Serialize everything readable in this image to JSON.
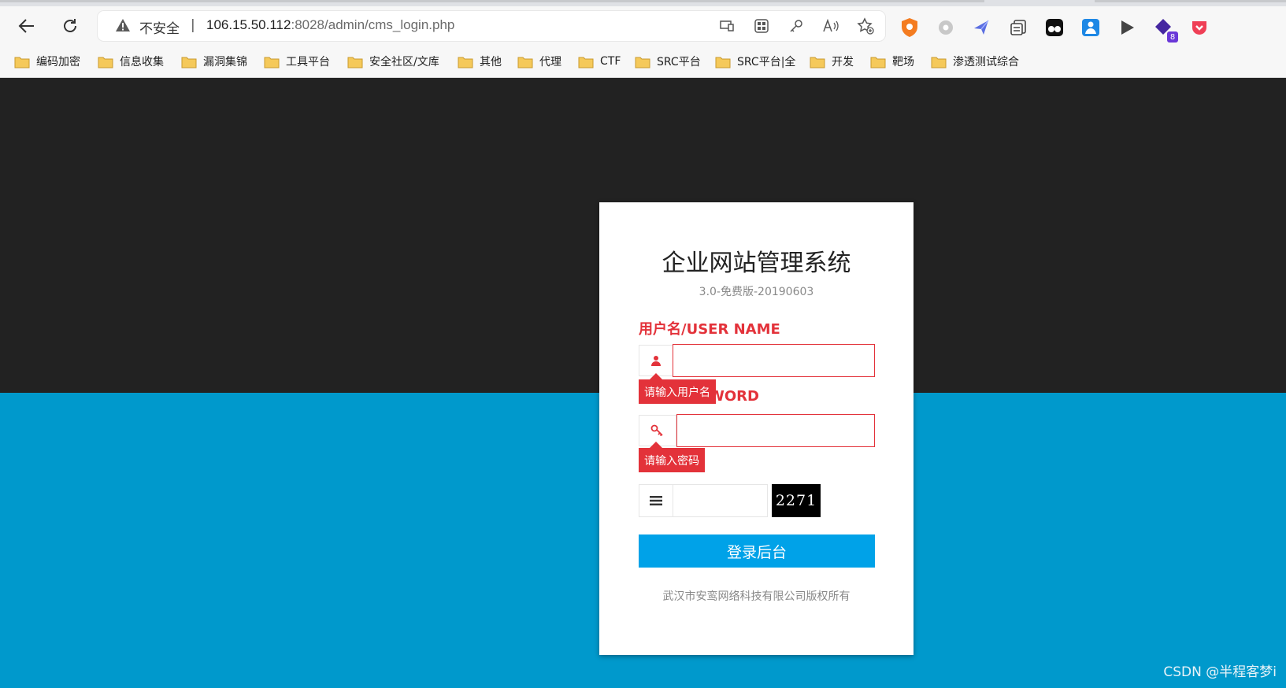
{
  "browser": {
    "insecure_label": "不安全",
    "url_host": "106.15.50.112",
    "url_path": ":8028/admin/cms_login.php",
    "bookmarks": [
      "编码加密",
      "信息收集",
      "漏洞集锦",
      "工具平台",
      "安全社区/文库",
      "其他",
      "代理",
      "CTF",
      "SRC平台",
      "SRC平台|全",
      "开发",
      "靶场",
      "渗透测试综合"
    ],
    "extension_badge": "8"
  },
  "page": {
    "title": "企业网站管理系统",
    "version": "3.0-免费版-20190603",
    "username_label": "用户名/USER NAME",
    "username_tooltip": "请输入用户名",
    "password_label_visible": "WORD",
    "password_tooltip": "请输入密码",
    "captcha_code": "2271",
    "login_button": "登录后台",
    "copyright": "武汉市安鸾网络科技有限公司版权所有"
  },
  "watermark": "CSDN @半程客梦i",
  "colors": {
    "header_bg": "#222222",
    "lower_bg": "#0099cc",
    "accent_red": "#e3323a",
    "button_blue": "#00a2e8"
  }
}
